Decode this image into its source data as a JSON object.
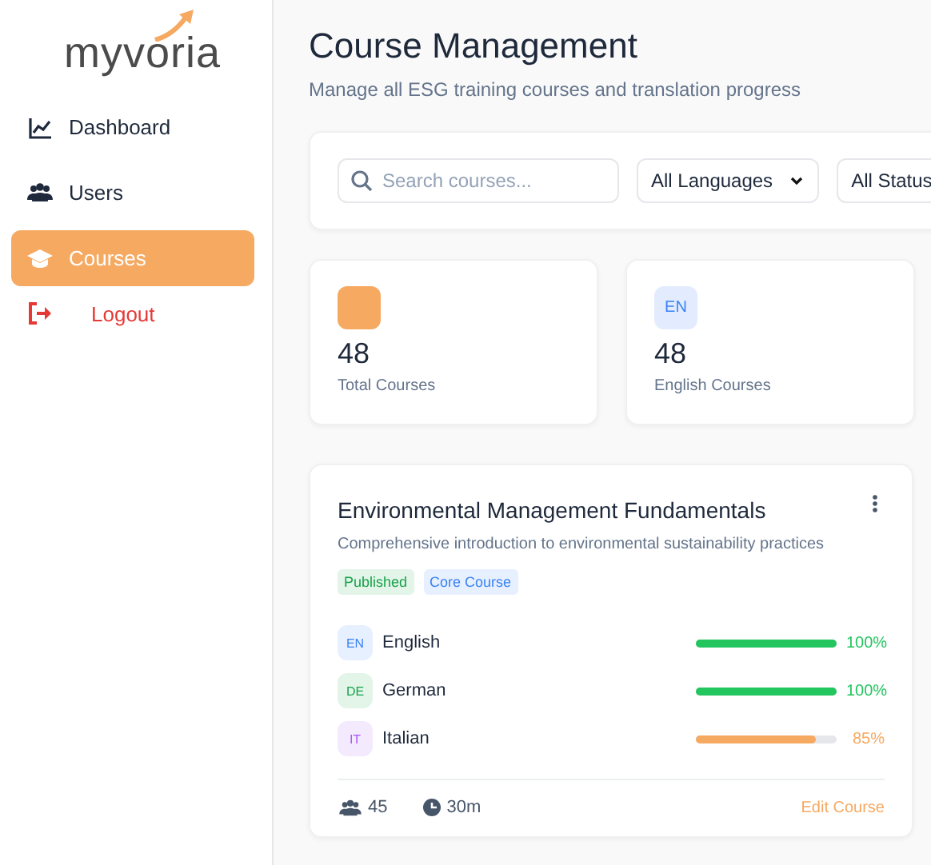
{
  "sidebar": {
    "logo": "myvoria",
    "items": [
      {
        "kind": "chart",
        "label": "Dashboard",
        "selected": false
      },
      {
        "kind": "users",
        "label": "Users",
        "selected": false
      },
      {
        "kind": "cap",
        "label": "Courses",
        "selected": true
      },
      {
        "kind": "logout",
        "label": "Logout",
        "selected": false
      }
    ]
  },
  "header": {
    "title": "Course Management",
    "subtitle": "Manage all ESG training courses and translation progress"
  },
  "filters": {
    "search": {
      "placeholder": "Search courses..."
    },
    "selects": [
      {
        "value": "All Languages",
        "caret": true
      },
      {
        "value": "All Status",
        "caret": false
      }
    ]
  },
  "stats": [
    {
      "color": "#f6a961",
      "value": "48",
      "label": "Total Courses"
    },
    {
      "badge": "EN",
      "color": "#3b82f6",
      "value": "48",
      "label": "English Courses"
    }
  ],
  "course": {
    "title": "Environmental Management Fundamentals",
    "description": "Comprehensive introduction to environmental sustainability practices",
    "tags": [
      {
        "label": "Published",
        "color": "#16a34a"
      },
      {
        "label": "Core Course",
        "color": "#3b82f6"
      }
    ],
    "languages": [
      {
        "code": "EN",
        "name": "English",
        "color": "#3b82f6",
        "level": 1,
        "reading": "100%"
      },
      {
        "code": "DE",
        "name": "German",
        "color": "#16a34a",
        "level": 1,
        "reading": "100%"
      },
      {
        "code": "IT",
        "name": "Italian",
        "color": "#a855f7",
        "level": 0.85,
        "reading": "85%"
      }
    ],
    "learners": "45",
    "duration": "30m",
    "action": "Edit Course"
  }
}
